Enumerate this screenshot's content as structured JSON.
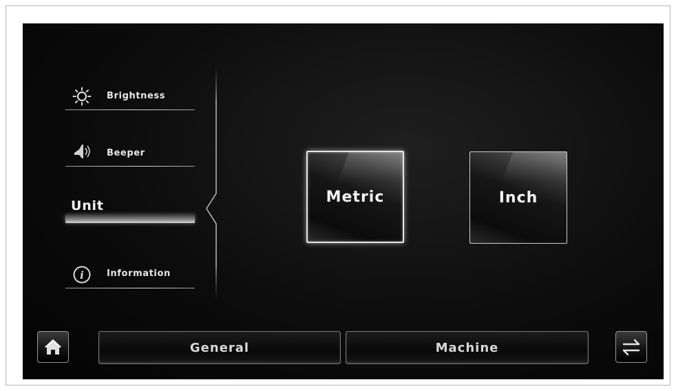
{
  "sidebar": {
    "items": [
      {
        "label": "Brightness",
        "icon": "sun-icon"
      },
      {
        "label": "Beeper",
        "icon": "speaker-icon"
      },
      {
        "label": "Unit",
        "icon": "",
        "active": true
      },
      {
        "label": "Information",
        "icon": "info-icon"
      }
    ]
  },
  "unit": {
    "options": [
      {
        "label": "Metric",
        "selected": true
      },
      {
        "label": "Inch",
        "selected": false
      }
    ]
  },
  "bottom": {
    "home_icon": "home-icon",
    "tabs": [
      {
        "label": "General"
      },
      {
        "label": "Machine"
      }
    ],
    "swap_icon": "swap-arrows-icon"
  }
}
